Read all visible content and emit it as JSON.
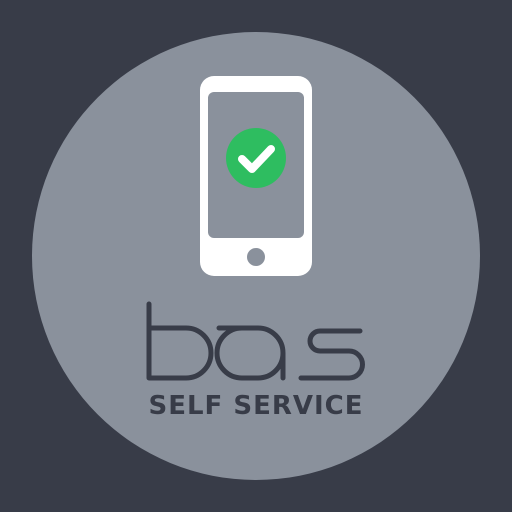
{
  "brand": {
    "wordmark": "bas",
    "tagline": "SELF SERVICE"
  },
  "colors": {
    "background": "#383c48",
    "circle": "#8a919c",
    "phone_body": "#ffffff",
    "phone_screen": "#8a919c",
    "check_badge": "#2ebd60",
    "text": "#383c48"
  },
  "icons": {
    "phone": "smartphone-icon",
    "status": "check-circle-icon"
  }
}
